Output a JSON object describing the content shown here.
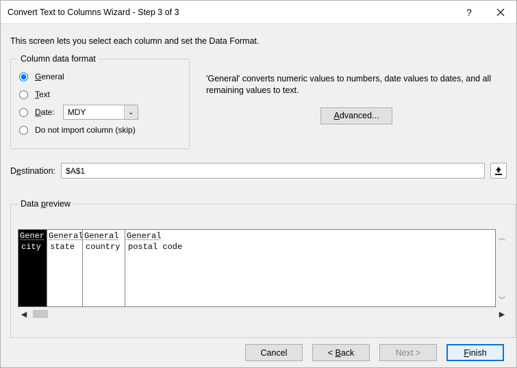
{
  "window": {
    "title": "Convert Text to Columns Wizard - Step 3 of 3"
  },
  "intro": "This screen lets you select each column and set the Data Format.",
  "format": {
    "legend": "Column data format",
    "opt_general": "General",
    "opt_text": "Text",
    "opt_date": "Date:",
    "date_value": "MDY",
    "opt_skip": "Do not import column (skip)",
    "description": "'General' converts numeric values to numbers, date values to dates, and all remaining values to text.",
    "advanced": "Advanced..."
  },
  "destination": {
    "label": "Destination:",
    "value": "$A$1"
  },
  "preview": {
    "legend": "Data preview",
    "headers": [
      "Gener",
      "General",
      "General",
      "General"
    ],
    "row1": [
      "city",
      "state",
      "country",
      "postal code"
    ]
  },
  "buttons": {
    "cancel": "Cancel",
    "back": "< Back",
    "next": "Next >",
    "finish": "Finish"
  }
}
